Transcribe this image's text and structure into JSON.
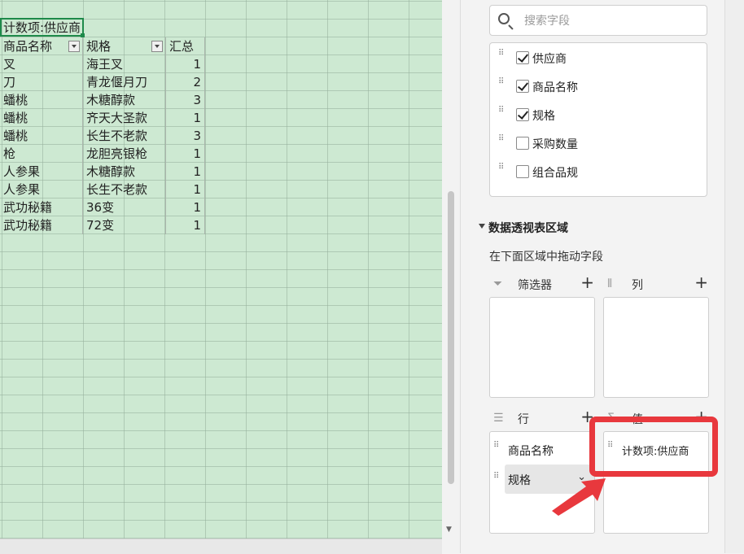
{
  "sheet": {
    "pivot_title": "计数项:供应商",
    "headers": [
      "商品名称",
      "规格",
      "汇总"
    ],
    "rows": [
      [
        "叉",
        "海王叉",
        "1"
      ],
      [
        "刀",
        "青龙偃月刀",
        "2"
      ],
      [
        "蟠桃",
        "木糖醇款",
        "3"
      ],
      [
        "蟠桃",
        "齐天大圣款",
        "1"
      ],
      [
        "蟠桃",
        "长生不老款",
        "3"
      ],
      [
        "枪",
        "龙胆亮银枪",
        "1"
      ],
      [
        "人参果",
        "木糖醇款",
        "1"
      ],
      [
        "人参果",
        "长生不老款",
        "1"
      ],
      [
        "武功秘籍",
        "36变",
        "1"
      ],
      [
        "武功秘籍",
        "72变",
        "1"
      ]
    ],
    "background_color": "#cde9d2",
    "selection_color": "#1e8a4a"
  },
  "panel": {
    "search_placeholder": "搜索字段",
    "fields": [
      {
        "label": "供应商",
        "checked": true
      },
      {
        "label": "商品名称",
        "checked": true
      },
      {
        "label": "规格",
        "checked": true
      },
      {
        "label": "采购数量",
        "checked": false
      },
      {
        "label": "组合品规",
        "checked": false
      }
    ],
    "area_title": "数据透视表区域",
    "area_hint": "在下面区域中拖动字段",
    "zones": {
      "filter_label": "筛选器",
      "column_label": "列",
      "row_label": "行",
      "value_label": "值"
    },
    "row_items": [
      "商品名称",
      "规格"
    ],
    "value_items": [
      "计数项:供应商"
    ],
    "plus": "+"
  },
  "annotation": {
    "color": "#e8383d"
  }
}
